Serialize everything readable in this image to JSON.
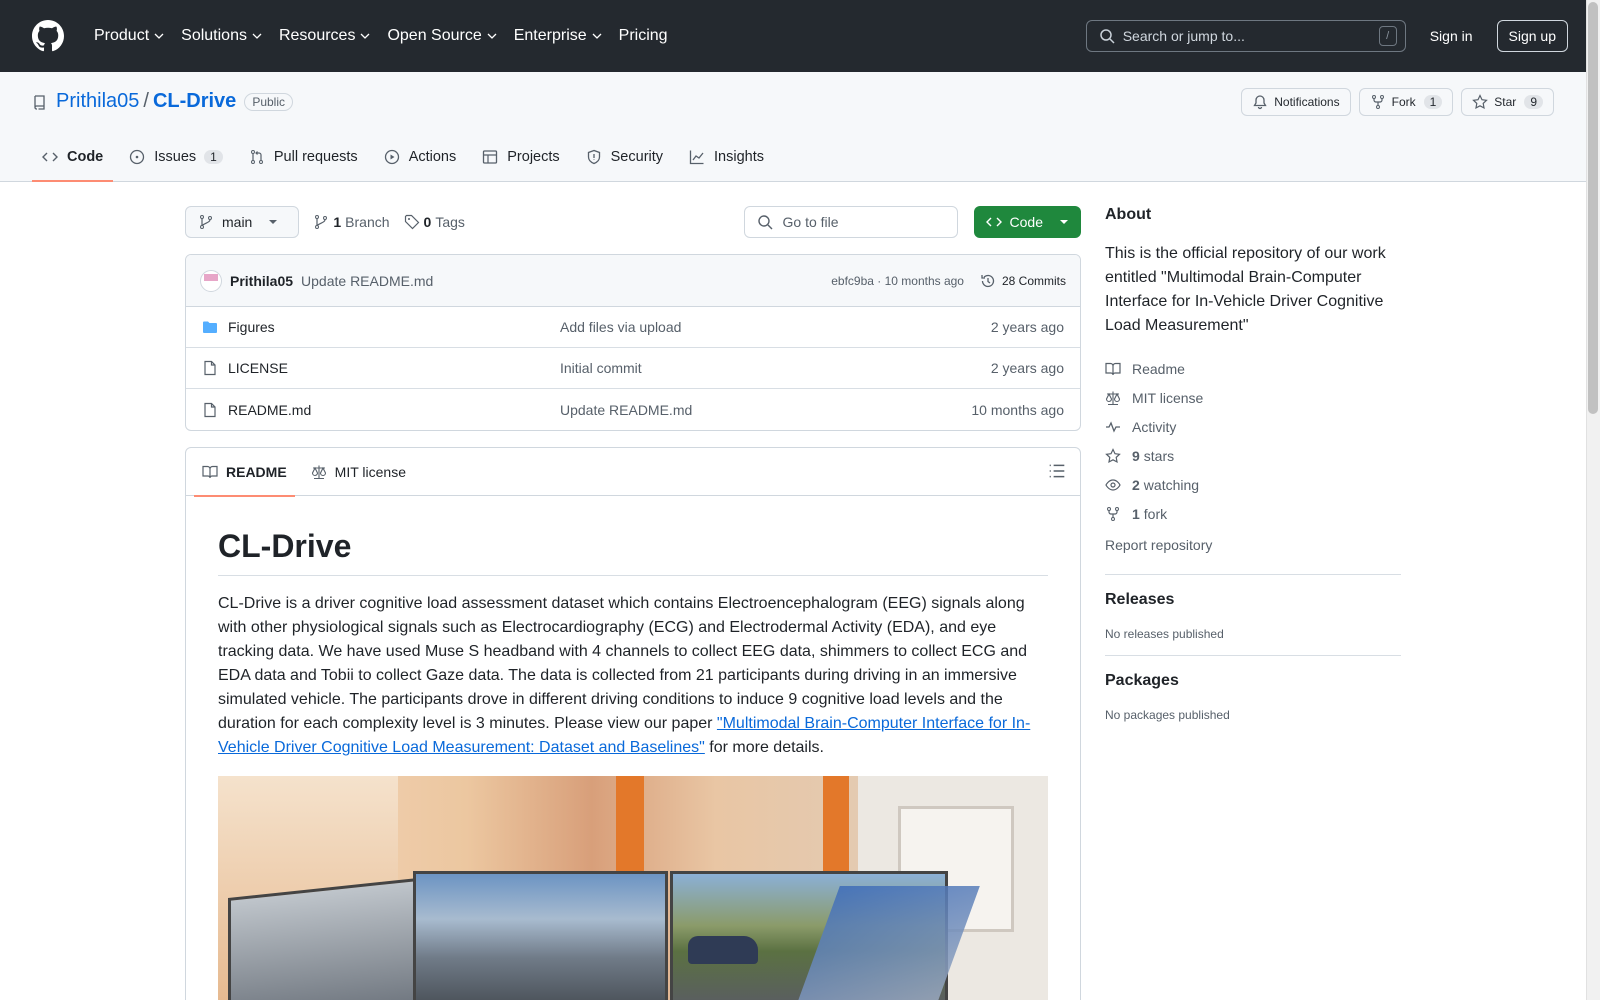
{
  "header": {
    "nav": [
      "Product",
      "Solutions",
      "Resources",
      "Open Source",
      "Enterprise",
      "Pricing"
    ],
    "search_placeholder": "Search or jump to...",
    "search_shortcut": "/",
    "signin": "Sign in",
    "signup": "Sign up"
  },
  "repo": {
    "owner": "Prithila05",
    "separator": "/",
    "name": "CL-Drive",
    "visibility": "Public",
    "notifications": "Notifications",
    "fork_label": "Fork",
    "fork_count": "1",
    "star_label": "Star",
    "star_count": "9",
    "tabs": [
      {
        "label": "Code",
        "icon": "code-icon"
      },
      {
        "label": "Issues",
        "icon": "issue-icon",
        "count": "1"
      },
      {
        "label": "Pull requests",
        "icon": "pull-request-icon"
      },
      {
        "label": "Actions",
        "icon": "play-icon"
      },
      {
        "label": "Projects",
        "icon": "table-icon"
      },
      {
        "label": "Security",
        "icon": "shield-icon"
      },
      {
        "label": "Insights",
        "icon": "graph-icon"
      }
    ]
  },
  "toolbar": {
    "branch": "main",
    "branch_count": "1",
    "branch_label": "Branch",
    "tag_count": "0",
    "tag_label": "Tags",
    "goto_placeholder": "Go to file",
    "code_button": "Code"
  },
  "commit": {
    "author": "Prithila05",
    "message": "Update README.md",
    "meta": "ebfc9ba · 10 months ago",
    "commits": "28 Commits"
  },
  "files": [
    {
      "name": "Figures",
      "type": "folder",
      "message": "Add files via upload",
      "time": "2 years ago"
    },
    {
      "name": "LICENSE",
      "type": "file",
      "message": "Initial commit",
      "time": "2 years ago"
    },
    {
      "name": "README.md",
      "type": "file",
      "message": "Update README.md",
      "time": "10 months ago"
    }
  ],
  "readme": {
    "tab_readme": "README",
    "tab_license": "MIT license",
    "title": "CL-Drive",
    "paragraph_before": "CL-Drive is a driver cognitive load assessment dataset which contains Electroencephalogram (EEG) signals along with other physiological signals such as Electrocardiography (ECG) and Electrodermal Activity (EDA), and eye tracking data. We have used Muse S headband with 4 channels to collect EEG data, shimmers to collect ECG and EDA data and Tobii to collect Gaze data. The data is collected from 21 participants during driving in an immersive simulated vehicle. The participants drove in different driving conditions to induce 9 cognitive load levels and the duration for each complexity level is 3 minutes. Please view our paper ",
    "paper_link": "\"Multimodal Brain-Computer Interface for In-Vehicle Driver Cognitive Load Measurement: Dataset and Baselines\"",
    "paragraph_after": " for more details."
  },
  "about": {
    "heading": "About",
    "description": "This is the official repository of our work entitled \"Multimodal Brain-Computer Interface for In-Vehicle Driver Cognitive Load Measurement\"",
    "readme": "Readme",
    "license": "MIT license",
    "activity": "Activity",
    "stars_count": "9",
    "stars_label": "stars",
    "watching_count": "2",
    "watching_label": "watching",
    "fork_count": "1",
    "fork_label": "fork",
    "report": "Report repository"
  },
  "releases": {
    "heading": "Releases",
    "text": "No releases published"
  },
  "packages": {
    "heading": "Packages",
    "text": "No packages published"
  },
  "colors": {
    "header_bg": "#24292f",
    "accent": "#0969da",
    "code_button": "#1f883d",
    "tab_underline": "#fd8c73"
  }
}
